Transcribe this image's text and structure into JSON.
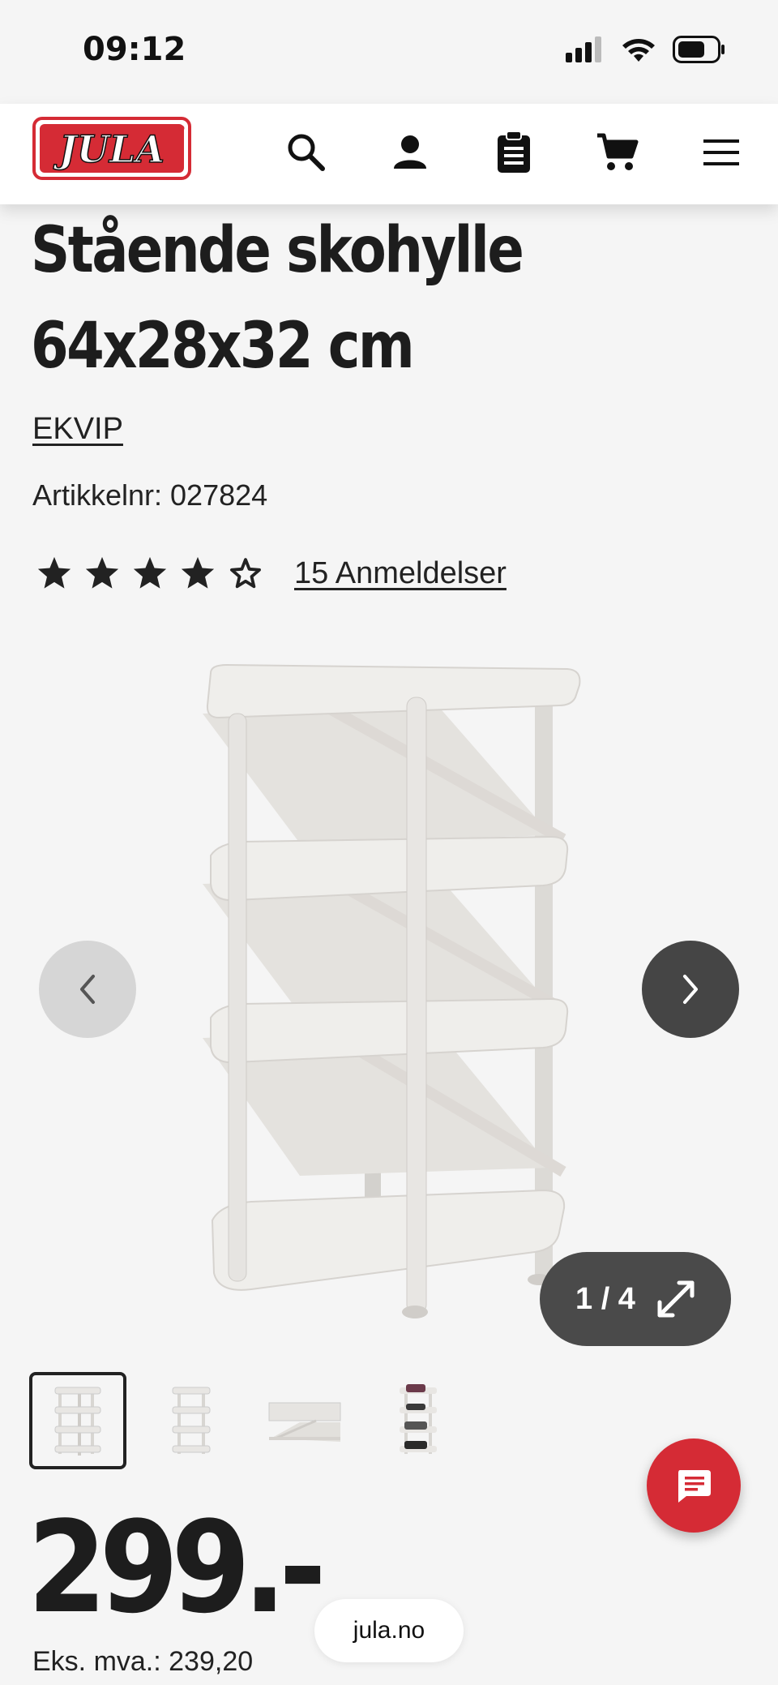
{
  "status_bar": {
    "time": "09:12"
  },
  "header": {
    "logo_text": "JULA",
    "brand_color": "#d52b35",
    "icons": [
      "search-icon",
      "account-icon",
      "shopping-list-icon",
      "cart-icon",
      "menu-icon"
    ]
  },
  "product": {
    "title_line1": "Stående skohylle",
    "title_line2": "64x28x32 cm",
    "brand": "EKVIP",
    "article_label": "Artikkelnr:",
    "article_number": "027824",
    "rating": 4,
    "rating_max": 5,
    "reviews_label": "15 Anmeldelser"
  },
  "gallery": {
    "counter": "1 / 4",
    "current": 1,
    "total": 4
  },
  "price": {
    "amount": "299.-",
    "ex_vat": "Eks. mva.: 239,20"
  },
  "browser": {
    "url": "jula.no"
  }
}
